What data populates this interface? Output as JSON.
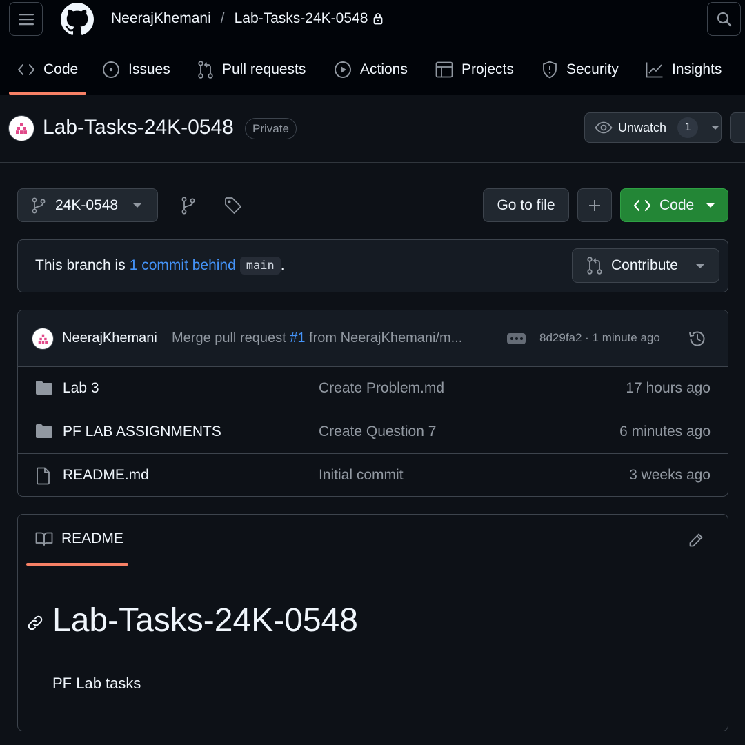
{
  "header": {
    "owner": "NeerajKhemani",
    "separator": "/",
    "repo": "Lab-Tasks-24K-0548",
    "icons": {
      "menu": "hamburger-icon",
      "logo": "github-logo",
      "search": "search-icon",
      "lock": "lock-icon"
    }
  },
  "tabs": [
    {
      "label": "Code",
      "icon": "code-icon",
      "selected": true
    },
    {
      "label": "Issues",
      "icon": "issue-icon"
    },
    {
      "label": "Pull requests",
      "icon": "pull-request-icon"
    },
    {
      "label": "Actions",
      "icon": "play-icon"
    },
    {
      "label": "Projects",
      "icon": "table-icon"
    },
    {
      "label": "Security",
      "icon": "shield-icon"
    },
    {
      "label": "Insights",
      "icon": "graph-icon"
    }
  ],
  "repo_header": {
    "title": "Lab-Tasks-24K-0548",
    "visibility": "Private",
    "unwatch_label": "Unwatch",
    "watch_count": "1"
  },
  "branch_bar": {
    "branch": "24K-0548",
    "goto_file": "Go to file",
    "add": "+",
    "code_label": "Code"
  },
  "banner": {
    "prefix": "This branch is",
    "link": "1 commit behind",
    "base_branch": "main",
    "suffix": ".",
    "contribute": "Contribute"
  },
  "latest_commit": {
    "author": "NeerajKhemani",
    "message_prefix": "Merge pull request ",
    "pr_link": "#1",
    "message_suffix": " from NeerajKhemani/m...",
    "meta": "8d29fa2 · 1 minute ago"
  },
  "files": [
    {
      "name": "Lab 3",
      "type": "folder",
      "commit": "Create Problem.md",
      "time": "17 hours ago"
    },
    {
      "name": "PF LAB ASSIGNMENTS",
      "type": "folder",
      "commit": "Create Question 7",
      "time": "6 minutes ago"
    },
    {
      "name": "README.md",
      "type": "file",
      "commit": "Initial commit",
      "time": "3 weeks ago"
    }
  ],
  "readme": {
    "tab_label": "README",
    "heading": "Lab-Tasks-24K-0548",
    "body": "PF Lab tasks"
  },
  "colors": {
    "background": "#0d1117",
    "header_bg": "#010409",
    "accent_underline": "#f78166",
    "link": "#4493f8",
    "primary_button": "#238636"
  }
}
